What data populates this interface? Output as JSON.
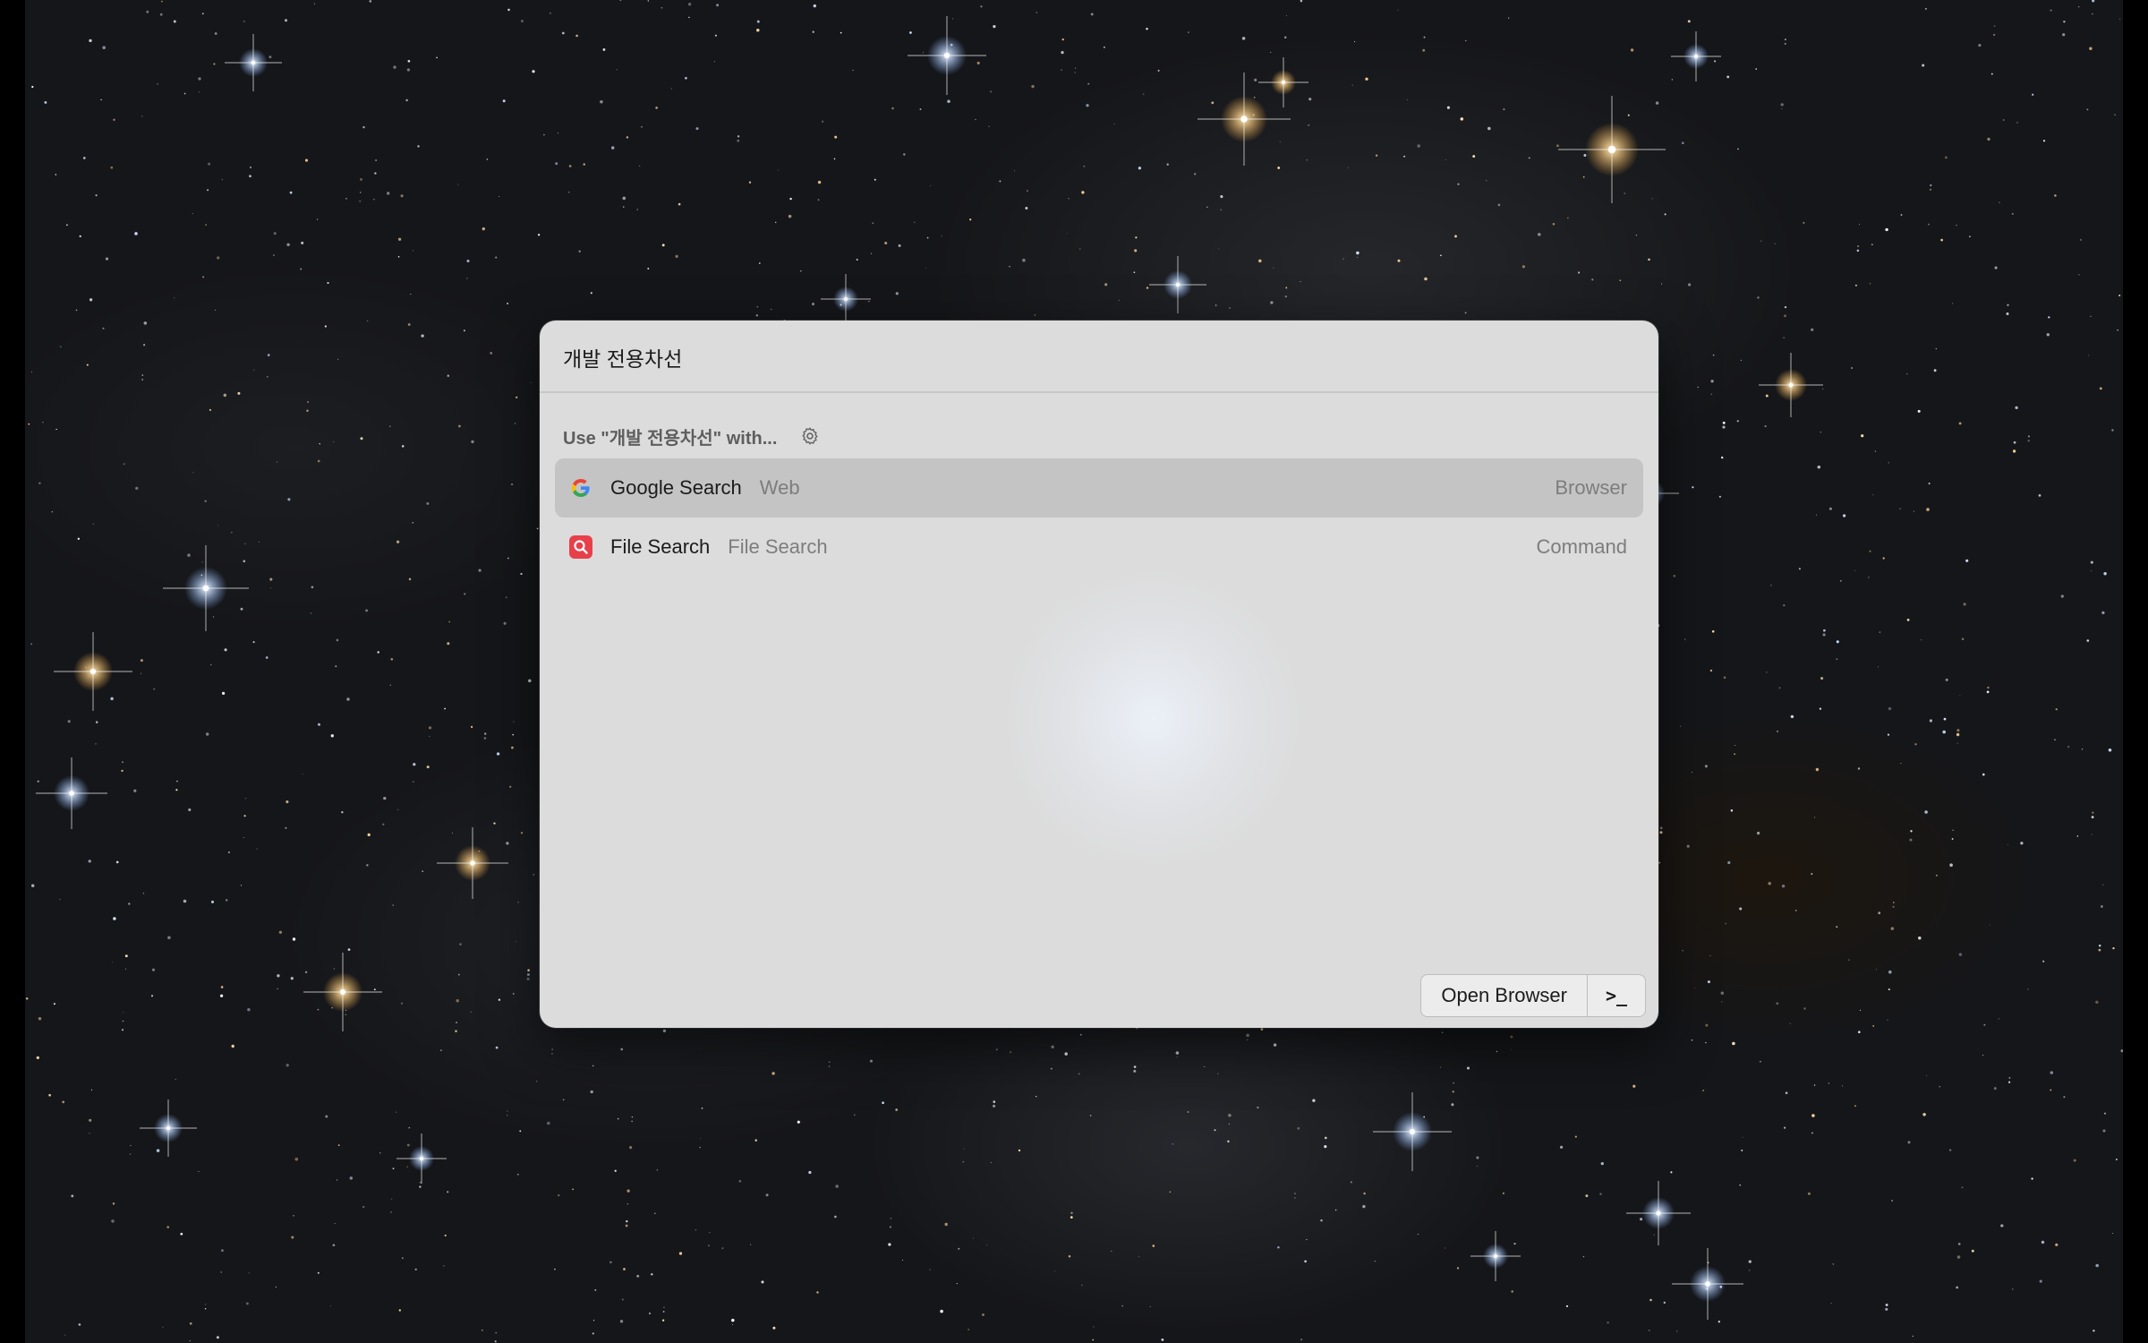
{
  "search": {
    "query": "개발 전용차선"
  },
  "section": {
    "title": "Use \"개발 전용차선\" with...",
    "settings_icon": "gear-icon"
  },
  "results": [
    {
      "icon": "google-icon",
      "title": "Google Search",
      "subtitle": "Web",
      "accessory": "Browser",
      "selected": true
    },
    {
      "icon": "file-search-icon",
      "title": "File Search",
      "subtitle": "File Search",
      "accessory": "Command",
      "selected": false
    }
  ],
  "actions": {
    "primary_label": "Open Browser",
    "secondary_label": ">_",
    "secondary_icon": "terminal-icon"
  },
  "colors": {
    "selection": "#b0b0b0",
    "file_search_icon": "#e8404a"
  }
}
